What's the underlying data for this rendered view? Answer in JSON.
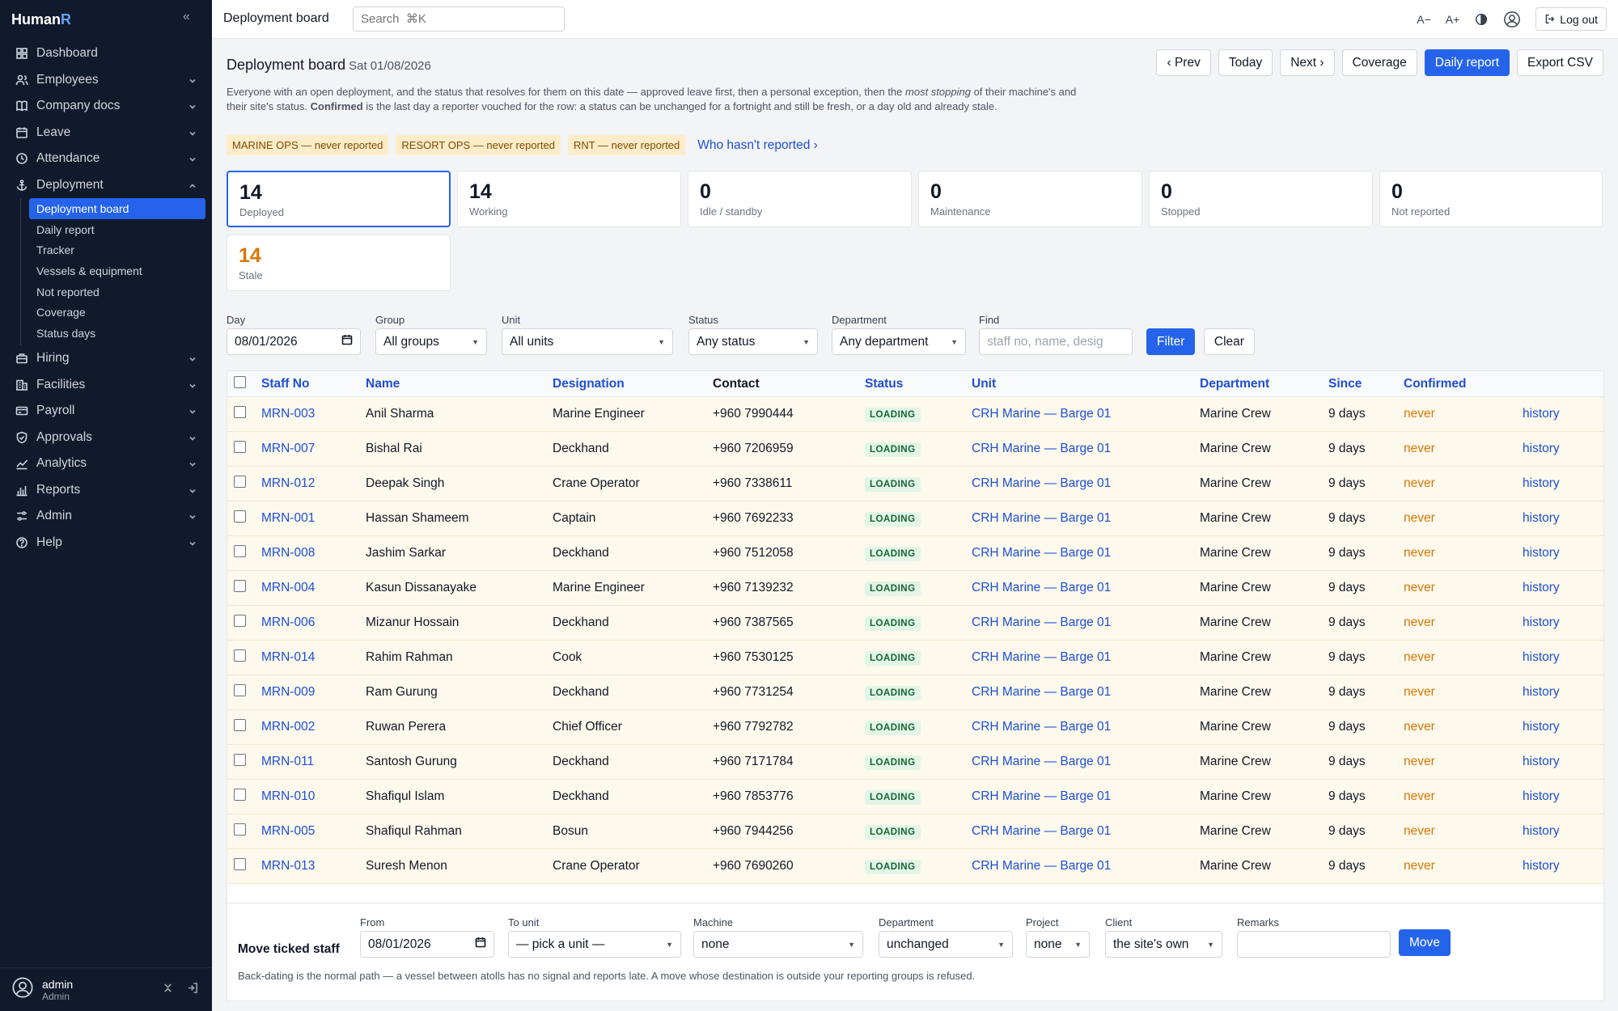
{
  "app": {
    "brand_main": "Human",
    "brand_accent": "R"
  },
  "sidebar": {
    "items": [
      {
        "label": "Dashboard",
        "icon": "grid-icon",
        "chev": false
      },
      {
        "label": "Employees",
        "icon": "users-icon",
        "chev": "down"
      },
      {
        "label": "Company docs",
        "icon": "book-icon",
        "chev": "down"
      },
      {
        "label": "Leave",
        "icon": "calendar-icon",
        "chev": "down"
      },
      {
        "label": "Attendance",
        "icon": "clock-icon",
        "chev": "down"
      },
      {
        "label": "Deployment",
        "icon": "anchor-icon",
        "chev": "up"
      }
    ],
    "deployment_sub": [
      "Deployment board",
      "Daily report",
      "Tracker",
      "Vessels & equipment",
      "Not reported",
      "Coverage",
      "Status days"
    ],
    "items_after": [
      {
        "label": "Hiring",
        "icon": "briefcase-icon"
      },
      {
        "label": "Facilities",
        "icon": "building-icon"
      },
      {
        "label": "Payroll",
        "icon": "wallet-icon"
      },
      {
        "label": "Approvals",
        "icon": "shield-icon"
      },
      {
        "label": "Analytics",
        "icon": "chart-icon"
      },
      {
        "label": "Reports",
        "icon": "bar-chart-icon"
      },
      {
        "label": "Admin",
        "icon": "sliders-icon"
      },
      {
        "label": "Help",
        "icon": "help-icon"
      }
    ],
    "user": {
      "name": "admin",
      "role": "Admin"
    }
  },
  "topbar": {
    "title": "Deployment board",
    "search_placeholder": "Search  ⌘K",
    "font_smaller": "A−",
    "font_larger": "A+",
    "logout": "Log out"
  },
  "page": {
    "title": "Deployment board",
    "date": "Sat 01/08/2026",
    "actions": {
      "prev": "‹ Prev",
      "today": "Today",
      "next": "Next ›",
      "coverage": "Coverage",
      "daily_report": "Daily report",
      "export": "Export CSV"
    },
    "intro_1": "Everyone with an open deployment, and the status that resolves for them on this date — approved leave first, then a personal exception, then the ",
    "intro_em": "most stopping",
    "intro_2": " of their machine's and their site's status. ",
    "intro_strong": "Confirmed",
    "intro_3": " is the last day a reporter vouched for the row: a status can be unchanged for a fortnight and still be fresh, or a day old and already stale.",
    "chips": [
      "MARINE OPS — never reported",
      "RESORT OPS — never reported",
      "RNT — never reported"
    ],
    "chips_link": "Who hasn't reported ›"
  },
  "cards": [
    {
      "num": "14",
      "label": "Deployed"
    },
    {
      "num": "14",
      "label": "Working"
    },
    {
      "num": "0",
      "label": "Idle / standby"
    },
    {
      "num": "0",
      "label": "Maintenance"
    },
    {
      "num": "0",
      "label": "Stopped"
    },
    {
      "num": "0",
      "label": "Not reported"
    },
    {
      "num": "14",
      "label": "Stale"
    }
  ],
  "filters": {
    "day_label": "Day",
    "day_value": "08/01/2026",
    "group_label": "Group",
    "group_value": "All groups",
    "unit_label": "Unit",
    "unit_value": "All units",
    "status_label": "Status",
    "status_value": "Any status",
    "department_label": "Department",
    "department_value": "Any department",
    "find_label": "Find",
    "find_placeholder": "staff no, name, desig",
    "filter_btn": "Filter",
    "clear_btn": "Clear"
  },
  "table": {
    "headers": [
      "Staff No",
      "Name",
      "Designation",
      "Contact",
      "Status",
      "Unit",
      "Department",
      "Since",
      "Confirmed"
    ],
    "rows": [
      [
        "MRN-003",
        "Anil Sharma",
        "Marine Engineer",
        "+960 7990444"
      ],
      [
        "MRN-007",
        "Bishal Rai",
        "Deckhand",
        "+960 7206959"
      ],
      [
        "MRN-012",
        "Deepak Singh",
        "Crane Operator",
        "+960 7338611"
      ],
      [
        "MRN-001",
        "Hassan Shameem",
        "Captain",
        "+960 7692233"
      ],
      [
        "MRN-008",
        "Jashim Sarkar",
        "Deckhand",
        "+960 7512058"
      ],
      [
        "MRN-004",
        "Kasun Dissanayake",
        "Marine Engineer",
        "+960 7139232"
      ],
      [
        "MRN-006",
        "Mizanur Hossain",
        "Deckhand",
        "+960 7387565"
      ],
      [
        "MRN-014",
        "Rahim Rahman",
        "Cook",
        "+960 7530125"
      ],
      [
        "MRN-009",
        "Ram Gurung",
        "Deckhand",
        "+960 7731254"
      ],
      [
        "MRN-002",
        "Ruwan Perera",
        "Chief Officer",
        "+960 7792782"
      ],
      [
        "MRN-011",
        "Santosh Gurung",
        "Deckhand",
        "+960 7171784"
      ],
      [
        "MRN-010",
        "Shafiqul Islam",
        "Deckhand",
        "+960 7853776"
      ],
      [
        "MRN-005",
        "Shafiqul Rahman",
        "Bosun",
        "+960 7944256"
      ],
      [
        "MRN-013",
        "Suresh Menon",
        "Crane Operator",
        "+960 7690260"
      ]
    ],
    "common": {
      "status": "LOADING",
      "unit": "CRH Marine — Barge 01",
      "department": "Marine Crew",
      "since": "9 days",
      "confirmed": "never",
      "history": "history"
    }
  },
  "move": {
    "title": "Move ticked staff",
    "from_label": "From",
    "from_value": "08/01/2026",
    "to_label": "To unit",
    "to_value": "— pick a unit —",
    "machine_label": "Machine",
    "machine_value": "none",
    "department_label": "Department",
    "department_value": "unchanged",
    "project_label": "Project",
    "project_value": "none",
    "client_label": "Client",
    "client_value": "the site's own",
    "remarks_label": "Remarks",
    "move_btn": "Move",
    "note": "Back-dating is the normal path — a vessel between atolls has no signal and reports late. A move whose destination is outside your reporting groups is refused."
  }
}
